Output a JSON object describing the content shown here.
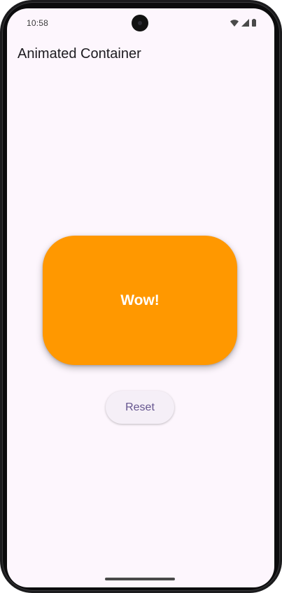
{
  "status_bar": {
    "time": "10:58",
    "icons": [
      "wifi-icon",
      "signal-icon",
      "battery-icon"
    ]
  },
  "app_bar": {
    "title": "Animated Container"
  },
  "animated_box": {
    "text": "Wow!",
    "color": "#ff9800"
  },
  "reset_button": {
    "label": "Reset",
    "accent_color": "#65558f"
  },
  "colors": {
    "background": "#fdf6fd",
    "box": "#ff9800",
    "text_on_box": "#ffffff"
  }
}
